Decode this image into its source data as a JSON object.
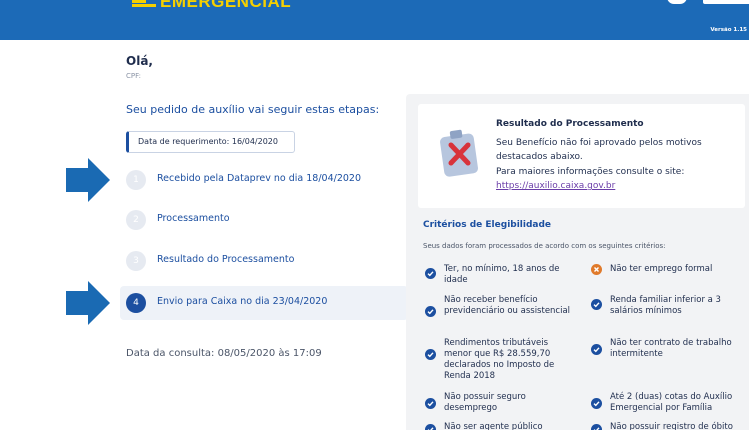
{
  "header": {
    "logo_text": "EMERGENCIAL",
    "version": "Versão 1.15"
  },
  "greeting": {
    "hello": "Olá,",
    "cpf_label": "CPF:"
  },
  "steps_title": "Seu pedido de auxílio vai seguir estas etapas:",
  "request_date": "Data de requerimento: 16/04/2020",
  "steps": [
    {
      "num": "1",
      "label": "Recebido pela Dataprev no dia 18/04/2020",
      "active": false
    },
    {
      "num": "2",
      "label": "Processamento",
      "active": false
    },
    {
      "num": "3",
      "label": "Resultado do Processamento",
      "active": false
    },
    {
      "num": "4",
      "label": "Envio para Caixa no dia 23/04/2020",
      "active": true
    }
  ],
  "consult_date": "Data da consulta: 08/05/2020 às 17:09",
  "result": {
    "title": "Resultado do Processamento",
    "line1": "Seu Benefício não foi aprovado pelos motivos",
    "line2": "destacados abaixo.",
    "line3": "Para maiores informações consulte o site:",
    "link": "https://auxilio.caixa.gov.br"
  },
  "criteria": {
    "title": "Critérios de Elegibilidade",
    "subtitle": "Seus dados foram processados de acordo com os seguintes critérios:",
    "items": [
      {
        "text": "Ter, no mínimo, 18 anos de idade",
        "status": "ok"
      },
      {
        "text": "Não ter emprego formal",
        "status": "failed"
      },
      {
        "text": "Não receber benefício previdenciário ou assistencial",
        "status": "ok"
      },
      {
        "text": "Renda familiar inferior a 3 salários mínimos",
        "status": "ok"
      },
      {
        "text": "Rendimentos tributáveis menor que R$ 28.559,70 declarados no Imposto de Renda 2018",
        "status": "ok"
      },
      {
        "text": "Não ter contrato de trabalho intermitente",
        "status": "ok"
      },
      {
        "text": "Não possuir seguro desemprego",
        "status": "ok"
      },
      {
        "text": "Até 2 (duas) cotas do Auxílio Emergencial por Família",
        "status": "ok"
      },
      {
        "text": "Não ser agente público",
        "status": "ok"
      },
      {
        "text": "Não possuir registro de óbito",
        "status": "ok"
      }
    ]
  },
  "colors": {
    "header_blue": "#1c6ab7",
    "accent_blue": "#1c4fa0",
    "logo_yellow": "#f5d000",
    "fail_orange": "#e07a2b",
    "arrow_blue": "#1a6ab3"
  },
  "icons": [
    "check-circle-icon",
    "x-circle-icon",
    "clipboard-x-icon",
    "arrow-right-icon"
  ]
}
